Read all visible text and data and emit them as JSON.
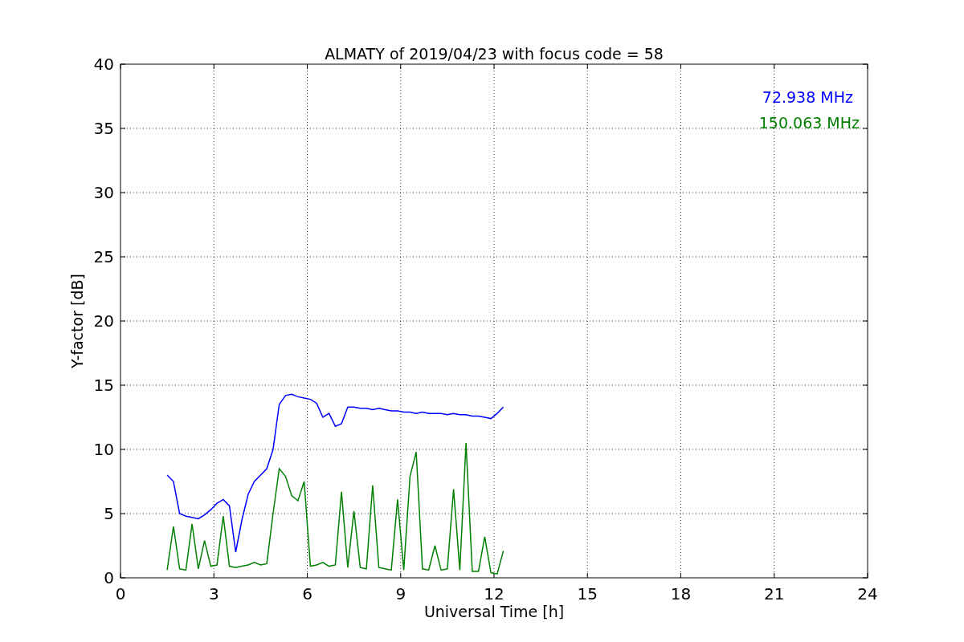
{
  "figure": {
    "chart_data": {
      "type": "line",
      "title": "ALMATY of 2019/04/23 with focus code = 58",
      "xlabel": "Universal Time [h]",
      "ylabel": "Y-factor [dB]",
      "x": [
        1.5,
        1.7,
        1.9,
        2.1,
        2.3,
        2.5,
        2.7,
        2.9,
        3.1,
        3.3,
        3.5,
        3.7,
        3.9,
        4.1,
        4.3,
        4.5,
        4.7,
        4.9,
        5.1,
        5.3,
        5.5,
        5.7,
        5.9,
        6.1,
        6.3,
        6.5,
        6.7,
        6.9,
        7.1,
        7.3,
        7.5,
        7.7,
        7.9,
        8.1,
        8.3,
        8.5,
        8.7,
        8.9,
        9.1,
        9.3,
        9.5,
        9.7,
        9.9,
        10.1,
        10.3,
        10.5,
        10.7,
        10.9,
        11.1,
        11.3,
        11.5,
        11.7,
        11.9,
        12.1,
        12.3
      ],
      "series": [
        {
          "name": "72.938 MHz",
          "color": "#0000ff",
          "values": [
            8.0,
            7.5,
            5.0,
            4.8,
            4.7,
            4.6,
            4.9,
            5.3,
            5.8,
            6.1,
            5.6,
            2.0,
            4.5,
            6.5,
            7.5,
            8.0,
            8.5,
            10.0,
            13.5,
            14.2,
            14.3,
            14.1,
            14.0,
            13.9,
            13.6,
            12.5,
            12.8,
            11.8,
            12.0,
            13.3,
            13.3,
            13.2,
            13.2,
            13.1,
            13.2,
            13.1,
            13.0,
            13.0,
            12.9,
            12.9,
            12.8,
            12.9,
            12.8,
            12.8,
            12.8,
            12.7,
            12.8,
            12.7,
            12.7,
            12.6,
            12.6,
            12.5,
            12.4,
            12.8,
            13.3
          ]
        },
        {
          "name": "150.063 MHz",
          "color": "#008000",
          "values": [
            0.6,
            4.0,
            0.7,
            0.6,
            4.2,
            0.7,
            2.9,
            0.9,
            1.0,
            4.8,
            0.9,
            0.8,
            0.9,
            1.0,
            1.2,
            1.0,
            1.1,
            5.0,
            8.5,
            7.9,
            6.4,
            6.0,
            7.5,
            0.9,
            1.0,
            1.2,
            0.9,
            1.0,
            6.7,
            0.8,
            5.2,
            0.8,
            0.7,
            7.2,
            0.8,
            0.7,
            0.6,
            6.1,
            0.6,
            7.9,
            9.8,
            0.7,
            0.6,
            2.5,
            0.6,
            0.7,
            6.9,
            0.6,
            10.5,
            0.5,
            0.5,
            3.2,
            0.4,
            0.3,
            2.1
          ]
        }
      ],
      "xlim": [
        0,
        24
      ],
      "ylim": [
        0,
        40
      ],
      "xticks": [
        0,
        3,
        6,
        9,
        12,
        15,
        18,
        21,
        24
      ],
      "yticks": [
        0,
        5,
        10,
        15,
        20,
        25,
        30,
        35,
        40
      ],
      "grid": true
    }
  }
}
